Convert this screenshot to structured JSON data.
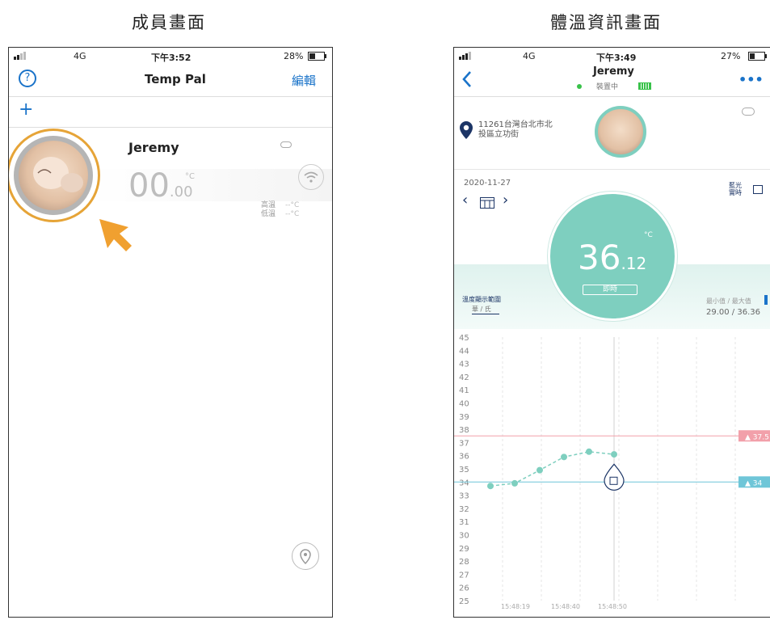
{
  "headings": {
    "left": "成員畫面",
    "right": "體溫資訊畫面"
  },
  "left_phone": {
    "status": {
      "signal": "",
      "network": "4G",
      "time": "下午3:52",
      "battery": "28%"
    },
    "nav": {
      "help_symbol": "?",
      "title": "Temp Pal",
      "edit_label": "編輯"
    },
    "add_symbol": "+",
    "member": {
      "name": "Jeremy",
      "temp_int": "00",
      "temp_dec": ".00",
      "unit": "°C",
      "stat_label_1": "高溫",
      "stat_label_2": "低溫",
      "stat_value_1": "--°C",
      "stat_value_2": "--°C"
    },
    "icons": {
      "wifi": "wifi-icon",
      "location": "location-pin-icon",
      "pointer": "pointer-arrow-icon"
    }
  },
  "right_phone": {
    "status": {
      "signal": "",
      "network": "4G",
      "time": "下午3:49",
      "battery": "27%"
    },
    "header": {
      "name": "Jeremy",
      "status_text": "裝置中",
      "more": "•••"
    },
    "address_line1": "11261台灣台北市北",
    "address_line2": "投區立功街",
    "date": "2020-11-27",
    "right_label": "藍光 實時",
    "temperature": {
      "int": "36",
      "dec": ".12",
      "unit": "°C",
      "badge": "即時"
    },
    "range_label": "溫度顯示範圍",
    "range_options": "華 / 氏",
    "minmax_label": "最小值 / 最大值",
    "minmax_value": "29.00 / 36.36",
    "high_alert": "37.5",
    "low_alert": "34",
    "colors": {
      "accent": "#7ecfbf",
      "high_line": "#f2a0aa",
      "low_line": "#6fc6d8"
    }
  },
  "chart_data": {
    "type": "line",
    "y_ticks": [
      "45",
      "44",
      "43",
      "42",
      "41",
      "40",
      "39",
      "38",
      "37",
      "36",
      "35",
      "34",
      "33",
      "32",
      "31",
      "30",
      "29",
      "28",
      "27",
      "26",
      "25"
    ],
    "ylim": [
      25,
      45
    ],
    "x_tick_labels": [
      "15:48:19",
      "15:48:40",
      "15:48:50"
    ],
    "series": [
      {
        "values": [
          33.7,
          33.9,
          34.9,
          35.9,
          36.3,
          36.1
        ]
      }
    ],
    "thresholds": {
      "high": 37.5,
      "low": 34
    }
  }
}
